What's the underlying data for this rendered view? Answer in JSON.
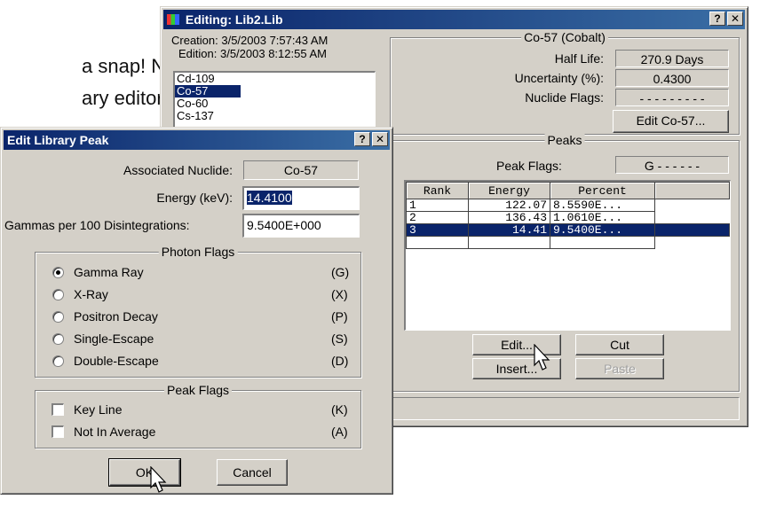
{
  "background": {
    "line1": "a snap! Not",
    "line2": "ary editor"
  },
  "library_window": {
    "title": "Editing: Lib2.Lib",
    "creation": "Creation: 3/5/2003  7:57:43 AM",
    "edition": "Edition: 3/5/2003  8:12:55 AM",
    "nuclides": [
      "Cd-109",
      "Co-57",
      "Co-60",
      "Cs-137"
    ],
    "selected_nuclide_index": 1,
    "nuclide_group_title": "Co-57 (Cobalt)",
    "half_life_label": "Half Life:",
    "half_life_value": "270.9 Days",
    "uncertainty_label": "Uncertainty (%):",
    "uncertainty_value": "0.4300",
    "nuclide_flags_label": "Nuclide Flags:",
    "nuclide_flags_value": "- - - - - - - - -",
    "edit_nuclide_button": "Edit Co-57...",
    "peaks_group_title": "Peaks",
    "peak_flags_label": "Peak Flags:",
    "peak_flags_value": "G - - - - - -",
    "peaks_table": {
      "headers": [
        "Rank",
        "Energy",
        "Percent"
      ],
      "rows": [
        {
          "rank": "1",
          "energy": "122.07",
          "percent": "8.5590E..."
        },
        {
          "rank": "2",
          "energy": "136.43",
          "percent": "1.0610E..."
        },
        {
          "rank": "3",
          "energy": "14.41",
          "percent": "9.5400E..."
        }
      ],
      "selected_row": 2
    },
    "buttons": {
      "edit": "Edit...",
      "cut": "Cut",
      "insert": "Insert...",
      "paste": "Paste"
    }
  },
  "peak_dialog": {
    "title": "Edit Library Peak",
    "associated_nuclide_label": "Associated Nuclide:",
    "associated_nuclide_value": "Co-57",
    "energy_label": "Energy (keV):",
    "energy_value": "14.4100",
    "gammas_label": "Gammas per 100 Disintegrations:",
    "gammas_value": "9.5400E+000",
    "photon_flags_title": "Photon Flags",
    "photon_flags": [
      {
        "label": "Gamma Ray",
        "key": "(G)",
        "selected": true
      },
      {
        "label": "X-Ray",
        "key": "(X)",
        "selected": false
      },
      {
        "label": "Positron Decay",
        "key": "(P)",
        "selected": false
      },
      {
        "label": "Single-Escape",
        "key": "(S)",
        "selected": false
      },
      {
        "label": "Double-Escape",
        "key": "(D)",
        "selected": false
      }
    ],
    "peak_flags_title": "Peak Flags",
    "peak_flags": [
      {
        "label": "Key Line",
        "key": "(K)",
        "checked": false
      },
      {
        "label": "Not In Average",
        "key": "(A)",
        "checked": false
      }
    ],
    "ok_button": "OK",
    "cancel_button": "Cancel"
  },
  "colors": {
    "title_active": "#0a246a",
    "face": "#d4d0c8",
    "selection": "#0a246a"
  }
}
